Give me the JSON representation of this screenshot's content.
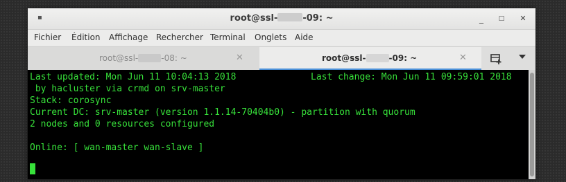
{
  "window": {
    "title_prefix": "root@ssl-",
    "title_suffix": "-09: ~",
    "menu_glyph": "▪",
    "minimize": "_",
    "maximize": "□",
    "close": "✕"
  },
  "menubar": {
    "items": [
      "Fichier",
      "Édition",
      "Affichage",
      "Rechercher",
      "Terminal",
      "Onglets",
      "Aide"
    ]
  },
  "tabs": [
    {
      "prefix": "root@ssl-",
      "suffix": "-08: ~",
      "active": false,
      "close": "✕"
    },
    {
      "prefix": "root@ssl-",
      "suffix": "-09: ~",
      "active": true,
      "close": "✕"
    }
  ],
  "new_tab_icon": "new-tab-icon",
  "terminal": {
    "lines": [
      "Last updated: Mon Jun 11 10:04:13 2018",
      " by hacluster via crmd on srv-master",
      "Stack: corosync",
      "Current DC: srv-master (version 1.1.14-70404b0) - partition with quorum",
      "2 nodes and 0 resources configured",
      "",
      "Online: [ wan-master wan-slave ]"
    ],
    "right_line": "Last change: Mon Jun 11 09:59:01 2018"
  },
  "colors": {
    "terminal_bg": "#000000",
    "terminal_fg": "#37e13a",
    "active_tab_underline": "#4a90d9"
  }
}
